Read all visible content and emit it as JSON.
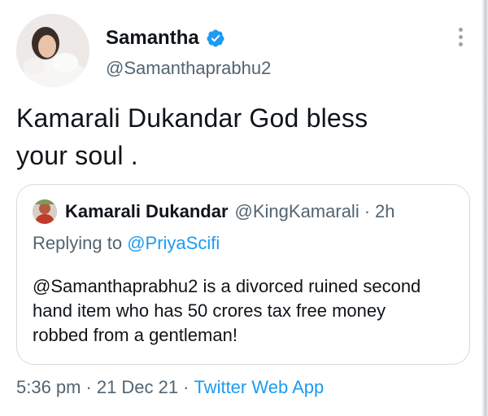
{
  "author": {
    "name": "Samantha",
    "handle": "@Samanthaprabhu2"
  },
  "tweet": {
    "text": "Kamarali Dukandar God bless\nyour soul ."
  },
  "quoted_tweet": {
    "author_name": "Kamarali Dukandar",
    "author_handle": "@KingKamarali",
    "separator": "·",
    "time": "2h",
    "replying_prefix": "Replying to ",
    "replying_to": "@PriyaScifi",
    "body": "@Samanthaprabhu2 is a divorced ruined second hand item who has 50 crores tax free money robbed from a gentleman!"
  },
  "meta": {
    "time": "5:36 pm",
    "sep1": "·",
    "date": "21 Dec 21",
    "sep2": "·",
    "source": "Twitter Web App"
  },
  "colors": {
    "accent": "#1d9bf0",
    "secondary_text": "#536471",
    "border": "#d6dbdf"
  },
  "icons": [
    "verified-badge-icon",
    "more-options-icon"
  ]
}
